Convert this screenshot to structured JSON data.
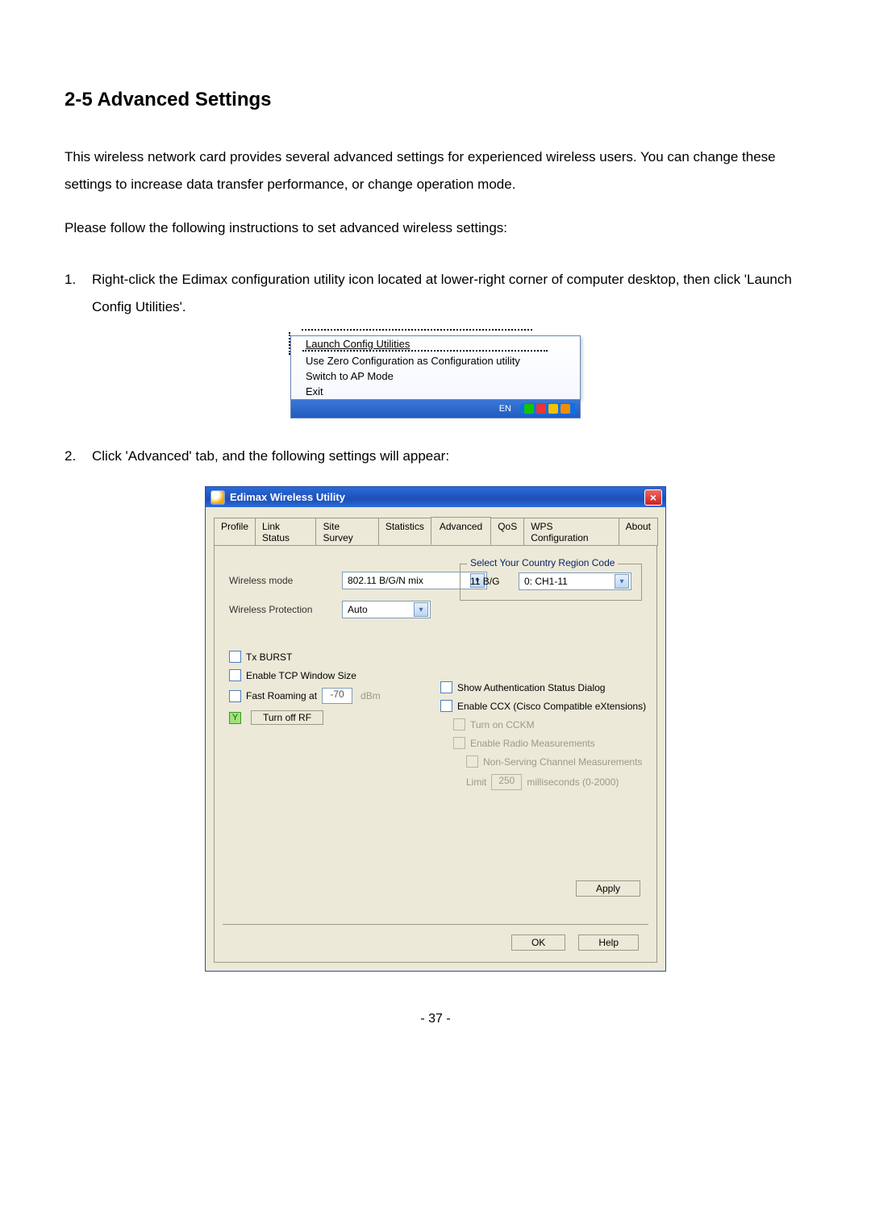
{
  "section_title": "2-5 Advanced Settings",
  "para1": "This wireless network card provides several advanced settings for experienced wireless users. You can change these settings to increase data transfer performance, or change operation mode.",
  "para2": "Please follow the following instructions to set advanced wireless settings:",
  "step1": "Right-click the Edimax configuration utility icon located at lower-right corner of computer desktop, then click 'Launch Config Utilities'.",
  "step2": "Click 'Advanced' tab, and the following settings will appear:",
  "context_menu": {
    "items": [
      "Launch Config Utilities",
      "Use Zero Configuration as Configuration utility",
      "Switch to AP Mode",
      "Exit"
    ],
    "language": "EN"
  },
  "dialog": {
    "title": "Edimax Wireless Utility",
    "tabs": [
      "Profile",
      "Link Status",
      "Site Survey",
      "Statistics",
      "Advanced",
      "QoS",
      "WPS Configuration",
      "About"
    ],
    "active_tab": "Advanced",
    "wireless_mode_label": "Wireless mode",
    "wireless_mode_value": "802.11 B/G/N mix",
    "wireless_protection_label": "Wireless Protection",
    "wireless_protection_value": "Auto",
    "region_legend": "Select Your Country Region Code",
    "region_line_label": "11 B/G",
    "region_line_value": "0: CH1-11",
    "tx_burst_label": "Tx BURST",
    "tcp_window_label": "Enable TCP Window Size",
    "fast_roaming_label": "Fast Roaming at",
    "fast_roaming_value": "-70",
    "fast_roaming_unit": "dBm",
    "turn_off_rf_label": "Turn off RF",
    "show_auth_label": "Show Authentication Status Dialog",
    "enable_ccx_label": "Enable CCX (Cisco Compatible eXtensions)",
    "turn_on_cckm_label": "Turn on CCKM",
    "enable_radio_label": "Enable Radio Measurements",
    "non_serving_label": "Non-Serving Channel Measurements",
    "limit_label": "Limit",
    "limit_value": "250",
    "limit_unit": "milliseconds (0-2000)",
    "apply_label": "Apply",
    "ok_label": "OK",
    "help_label": "Help"
  },
  "page_number": "- 37 -"
}
